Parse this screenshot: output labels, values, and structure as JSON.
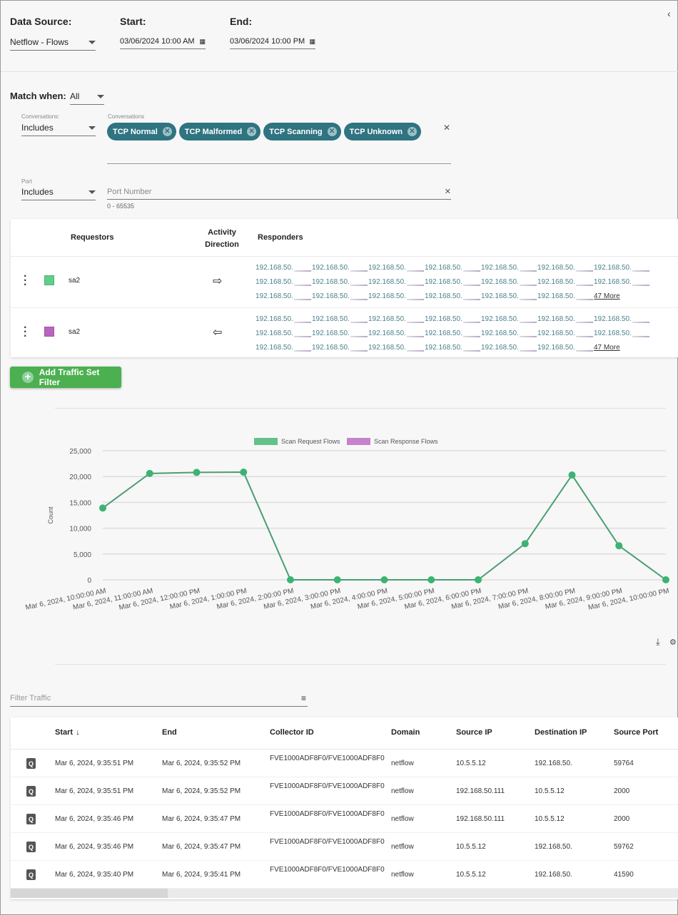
{
  "filters": {
    "data_source_label": "Data Source:",
    "data_source_value": "Netflow - Flows",
    "start_label": "Start:",
    "start_value": "03/06/2024 10:00 AM",
    "end_label": "End:",
    "end_value": "03/06/2024 10:00 PM"
  },
  "match": {
    "label": "Match when:",
    "value": "All",
    "conversations_label": "Conversations:",
    "conversations_mode": "Includes",
    "conversations_field_label": "Conversations",
    "chips": [
      "TCP Normal",
      "TCP Malformed",
      "TCP Scanning",
      "TCP Unknown"
    ],
    "port_label": "Port",
    "port_mode": "Includes",
    "port_placeholder": "Port Number",
    "port_hint": "0 - 65535"
  },
  "traffic_sets": {
    "headers": {
      "requestors": "Requestors",
      "direction": "Activity Direction",
      "responders": "Responders"
    },
    "rows": [
      {
        "name": "sa2",
        "color": "#5fcf8a",
        "direction": "right",
        "more": "47 More"
      },
      {
        "name": "sa2",
        "color": "#b965c0",
        "direction": "left",
        "more": "47 More"
      }
    ],
    "responder_ip": "192.168.50."
  },
  "add_filter_label": "Add Traffic Set Filter",
  "chart_data": {
    "type": "line",
    "ylabel": "Count",
    "ylim": [
      0,
      25000
    ],
    "yticks": [
      0,
      5000,
      10000,
      15000,
      20000,
      25000
    ],
    "ytick_labels": [
      "0",
      "5,000",
      "10,000",
      "15,000",
      "20,000",
      "25,000"
    ],
    "grid": true,
    "legend": "top",
    "categories": [
      "Mar 6, 2024, 10:00:00 AM",
      "Mar 6, 2024, 11:00:00 AM",
      "Mar 6, 2024, 12:00:00 PM",
      "Mar 6, 2024, 1:00:00 PM",
      "Mar 6, 2024, 2:00:00 PM",
      "Mar 6, 2024, 3:00:00 PM",
      "Mar 6, 2024, 4:00:00 PM",
      "Mar 6, 2024, 5:00:00 PM",
      "Mar 6, 2024, 6:00:00 PM",
      "Mar 6, 2024, 7:00:00 PM",
      "Mar 6, 2024, 8:00:00 PM",
      "Mar 6, 2024, 9:00:00 PM",
      "Mar 6, 2024, 10:00:00 PM"
    ],
    "series": [
      {
        "name": "Scan Request Flows",
        "color": "#3cb371",
        "values": [
          13900,
          20600,
          20800,
          20850,
          0,
          0,
          0,
          0,
          0,
          7000,
          20300,
          6600,
          0
        ]
      },
      {
        "name": "Scan Response Flows",
        "color": "#b965c0",
        "values": []
      }
    ]
  },
  "table": {
    "filter_placeholder": "Filter Traffic",
    "headers": [
      "Start",
      "End",
      "Collector ID",
      "Domain",
      "Source IP",
      "Destination IP",
      "Source Port"
    ],
    "rows": [
      [
        "Mar 6, 2024, 9:35:51 PM",
        "Mar 6, 2024, 9:35:52 PM",
        "FVE1000ADF8F0/FVE1000ADF8F0",
        "netflow",
        "10.5.5.12",
        "192.168.50.",
        "59764"
      ],
      [
        "Mar 6, 2024, 9:35:51 PM",
        "Mar 6, 2024, 9:35:52 PM",
        "FVE1000ADF8F0/FVE1000ADF8F0",
        "netflow",
        "192.168.50.111",
        "10.5.5.12",
        "2000"
      ],
      [
        "Mar 6, 2024, 9:35:46 PM",
        "Mar 6, 2024, 9:35:47 PM",
        "FVE1000ADF8F0/FVE1000ADF8F0",
        "netflow",
        "192.168.50.111",
        "10.5.5.12",
        "2000"
      ],
      [
        "Mar 6, 2024, 9:35:46 PM",
        "Mar 6, 2024, 9:35:47 PM",
        "FVE1000ADF8F0/FVE1000ADF8F0",
        "netflow",
        "10.5.5.12",
        "192.168.50.",
        "59762"
      ],
      [
        "Mar 6, 2024, 9:35:40 PM",
        "Mar 6, 2024, 9:35:41 PM",
        "FVE1000ADF8F0/FVE1000ADF8F0",
        "netflow",
        "10.5.5.12",
        "192.168.50.",
        "41590"
      ]
    ]
  }
}
